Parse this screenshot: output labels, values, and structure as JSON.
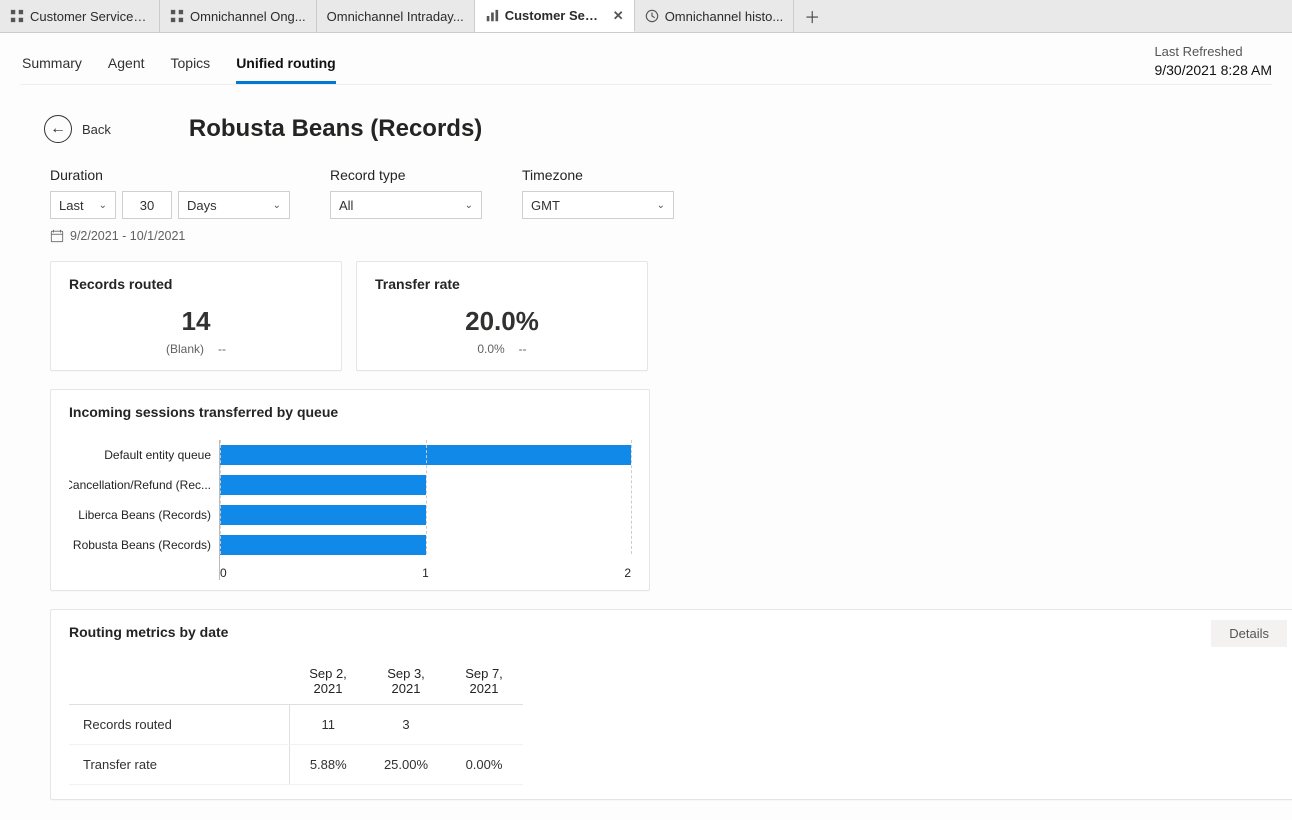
{
  "tabs": [
    {
      "label": "Customer Service A...",
      "icon": "grid"
    },
    {
      "label": "Omnichannel Ong...",
      "icon": "grid"
    },
    {
      "label": "Omnichannel Intraday...",
      "icon": "none"
    },
    {
      "label": "Customer Service historic...",
      "icon": "column",
      "active": true,
      "closeable": true
    },
    {
      "label": "Omnichannel histo...",
      "icon": "clock"
    }
  ],
  "subnav": {
    "items": [
      "Summary",
      "Agent",
      "Topics",
      "Unified routing"
    ],
    "active": "Unified routing"
  },
  "last_refreshed": {
    "label": "Last Refreshed",
    "timestamp": "9/30/2021 8:28 AM"
  },
  "back": {
    "label": "Back"
  },
  "page_title": "Robusta Beans (Records)",
  "filters": {
    "duration": {
      "label": "Duration",
      "mode": "Last",
      "count": "30",
      "unit": "Days",
      "range_text": "9/2/2021 - 10/1/2021"
    },
    "record_type": {
      "label": "Record type",
      "value": "All"
    },
    "timezone": {
      "label": "Timezone",
      "value": "GMT"
    }
  },
  "kpis": {
    "records_routed": {
      "title": "Records routed",
      "value": "14",
      "sub_label": "(Blank)",
      "sub_value": "--"
    },
    "transfer_rate": {
      "title": "Transfer rate",
      "value": "20.0%",
      "sub_label": "0.0%",
      "sub_value": "--"
    }
  },
  "chart_data": {
    "type": "bar",
    "orientation": "horizontal",
    "title": "Incoming sessions transferred by queue",
    "categories": [
      "Default entity queue",
      "Cancellation/Refund (Rec...",
      "Liberca Beans (Records)",
      "Robusta Beans (Records)"
    ],
    "values": [
      2,
      1,
      1,
      1
    ],
    "xlabel": "",
    "ylabel": "",
    "xlim": [
      0,
      2
    ],
    "ticks": [
      0,
      1,
      2
    ],
    "color": "#1089e9"
  },
  "routing_metrics": {
    "title": "Routing metrics by date",
    "details_label": "Details",
    "dates": [
      "Sep 2, 2021",
      "Sep 3, 2021",
      "Sep 7, 2021"
    ],
    "rows": [
      {
        "label": "Records routed",
        "values": [
          "11",
          "3",
          ""
        ]
      },
      {
        "label": "Transfer rate",
        "values": [
          "5.88%",
          "25.00%",
          "0.00%"
        ]
      }
    ]
  }
}
